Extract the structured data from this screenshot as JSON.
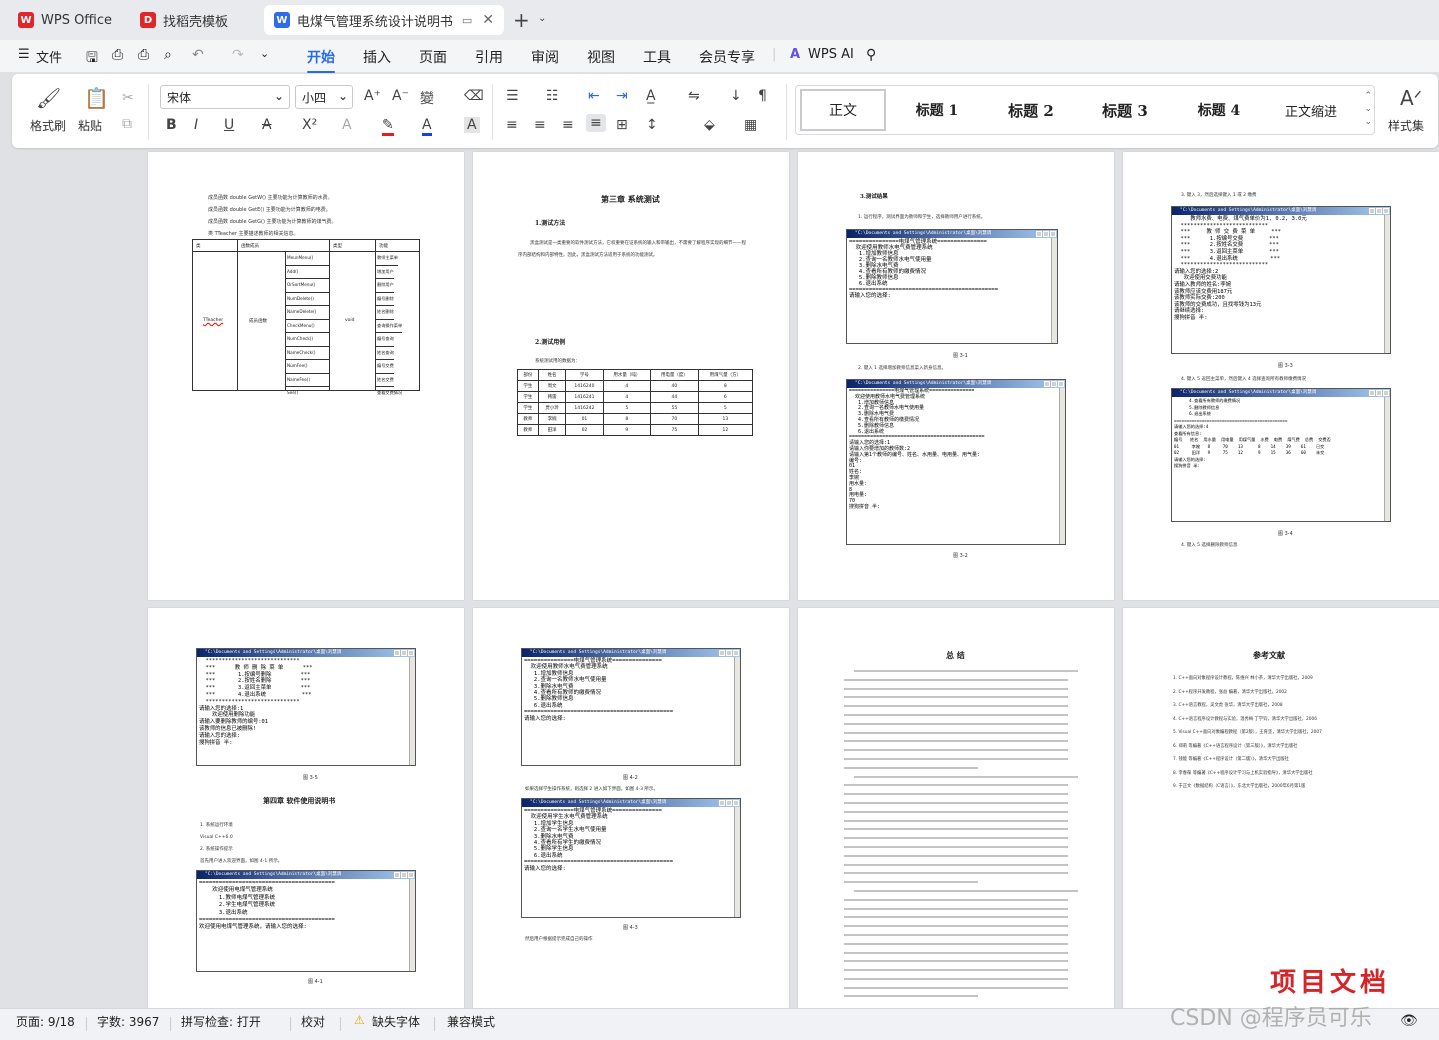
{
  "tabs": {
    "wps": "WPS Office",
    "template": "找稻壳模板",
    "doc": "电煤气管理系统设计说明书 .d"
  },
  "menu": {
    "file": "文件",
    "items": [
      "开始",
      "插入",
      "页面",
      "引用",
      "审阅",
      "视图",
      "工具",
      "会员专享"
    ],
    "ai": "WPS AI"
  },
  "ribbon": {
    "format_painter": "格式刷",
    "paste": "粘贴",
    "font": "宋体",
    "size": "小四",
    "styles": [
      "正文",
      "标题 1",
      "标题 2",
      "标题 3",
      "标题 4",
      "正文缩进"
    ],
    "style_set": "样式集"
  },
  "status": {
    "page": "页面: 9/18",
    "words": "字数: 3967",
    "spell": "拼写检查: 打开",
    "proof": "校对",
    "missing_font": "缺失字体",
    "compat": "兼容模式"
  },
  "doc": {
    "p9_lines": [
      "成员函数 double GetW() 主要功能为计算教师的水费。",
      "成员函数 double GetE() 主要功能为计算教师的电费。",
      "成员函数 double GetG() 主要功能为计算教师的煤气费。",
      "类 TTeacher 主要描述教师的相关信息。"
    ],
    "p9_table": {
      "header": [
        "类",
        "函数成员",
        "类型",
        "功能"
      ],
      "cls": "TTeacher",
      "member": "成员函数",
      "type": "void",
      "funcs": [
        "MeunMenu()",
        "Add()",
        "OrSortMenu()",
        "NumDelete()",
        "NameDelete()",
        "CheckMenu()",
        "NumCheck()",
        "NameCheck()",
        "NumFee()",
        "NameFee()",
        "See()"
      ],
      "desc": [
        "教师主菜单",
        "增加用户",
        "删除用户",
        "编号删除",
        "姓名删除",
        "查询操作菜单",
        "编号查询",
        "姓名查询",
        "编号交费",
        "姓名交费",
        "查看交费情况"
      ]
    },
    "ch3_title": "第三章 系统测试",
    "ch3_s1": "1.测试方法",
    "ch3_p1": "黑盒测试是一类重要的软件测试方法，它权重要在证系统的输入和带输出，不需要了解程序实现的细节——程序内部结构和内部特性。因此，黑盒测试方法适用于系统的功能测试。",
    "ch3_s2": "2.测试用例",
    "ch3_p2": "系统测试用的数据为：",
    "ch3_table": {
      "header": [
        "部份",
        "姓名",
        "学号",
        "用水量（吨）",
        "用电量（度）",
        "用煤气量（方）"
      ],
      "rows": [
        [
          "学生",
          "周文",
          "1416240",
          "4",
          "40",
          "8"
        ],
        [
          "学生",
          "韩雷",
          "1416241",
          "4",
          "44",
          "6"
        ],
        [
          "学生",
          "贾小玲",
          "1416242",
          "5",
          "55",
          "5"
        ],
        [
          "教师",
          "李婉",
          "01",
          "8",
          "70",
          "13"
        ],
        [
          "教师",
          "田洋",
          "02",
          "9",
          "75",
          "12"
        ]
      ]
    },
    "p11_heading": "3.测试结果",
    "p11_l1": "1. 运行程序，测试界面为教师和学生，选择教师用户进行系统。",
    "p11_l2": "2. 键入 1 选择增加教师信息菜入新身信息。",
    "console_title": "\"C:\\Documents and Settings\\Administrator\\桌面\\刘慧调",
    "console_menu": "===============电煤气管理系统===============\n  欢迎使用教师水电气费管理系统\n   1.增加教师信息\n   2.查询一名教师水电气使用量\n   3.删除水电气费\n   4.查看所有教师的缴费情况\n   5.删除教师信息\n   6.退出系统\n=============================================\n请输入您的选择:",
    "console_add": "===============电煤气管理系统===============\n  欢迎使用教师水电气费管理系统\n   1.增加教师信息\n   2.查询一名教师水电气使用量\n   3.删除水电气费\n   4.查看所有教师的缴费情况\n   5.删除教师信息\n   6.退出系统\n=============================================\n请输入您的选择:1\n请输入你要增加的教师数:2\n请输入第1个教师的编号、姓名、水用量、电用量、用气量:\n编号:\n01\n姓名:\n李婉\n用水量:\n8\n用电量:\n70\n搜狗拼音 半:",
    "p12_l1": "3. 键入 3，然后选择键入 1 或 2 缴费",
    "p12_l2": "4. 键入 5 返回主菜单，然后键入 4 选择查询所有教师缴费情况",
    "p12_l3": "4. 键入 5 选择删除教师信息",
    "console_fee": "     教师水费、电费、煤气费单价为1, 0.2, 3.0元\n  ***************************\n  ***     教 师 交 费 菜 单     ***\n  ***      1.按编号交费        ***\n  ***      2.按姓名交费        ***\n  ***      3.返回主菜单        ***\n  ***      4.退出系统          ***\n  ***************************\n请输入您的选择:2\n   欢迎使用交费功能\n请输入教师的姓名:李婉\n该教师应该交费用187元\n该教师实际交费:200\n该教师的交费成功，且找零钱为13元\n请继续选择:\n搜狗拼音 半:",
    "console_list": "      4.查看所有教师的缴费情况\n      5.删除教师信息\n      6.退出系统\n=============================================\n请输入您的选择:4\n查看所有信息:\n编号   姓名  用水量  用电量  用煤气量  水费  电费  煤气费  总费  交费否\n01     李婉   8     70    13      8    14    39    61    已交\n02     田洋   9     75    12      9    15    36    60    未交\n请输入您的选择:\n搜狗拼音 半:",
    "cap": [
      "图 3-1",
      "图 3-2",
      "图 3-3",
      "图 3-4",
      "图 3-5",
      "图 4-1",
      "图 4-2",
      "图 4-3"
    ],
    "console_del": "  *****************************\n  ***      教 师 删 除 菜 单      ***\n  ***       1.按编号删除         ***\n  ***       2.按姓名删除         ***\n  ***       3.返回主菜单         ***\n  ***       4.退出系统           ***\n  *****************************\n请输入您的选择:1\n    欢迎使用删除功能\n请输入要删除教师的编号:01\n该教师的信息已被删除!\n请输入您的选择:\n搜狗拼音 半:",
    "ch4_title": "第四章 软件使用说明书",
    "ch4_l1": "1. 系统运行环境",
    "ch4_l2": "Visual C++6.0",
    "ch4_l3": "2. 系统操作提示",
    "ch4_l4": "首先用户进入欢迎界面，如图 4-1 所示。",
    "console_welcome": "=========================================\n    欢迎使用电煤气管理系统\n      1.教师电煤气管理系统\n      2.学生电煤气管理系统\n      3.退出系统\n=========================================\n欢迎使用电煤气管理系统，请输入您的选择:",
    "p14_l1": "如果选择学生操作系统，则选择 2 进入如下界面，如图 4-3 所示。",
    "p14_l2": "然后用户根据提示完成自己的操作",
    "console_student": "===============电煤气管理系统===============\n  欢迎使用学生水电气费管理系统\n   1.增加学生信息\n   2.查询一名学生水电气使用量\n   3.删除水电气费\n   4.查看所有学生的缴费情况\n   5.删除学生信息\n   6.退出系统\n=============================================\n请输入您的选择:",
    "summary_title": "总 结",
    "refs_title": "参考文献",
    "refs": [
      "1. C++面向对象程序设计教程，陈维兴 林小茶，清华大学出版社，2009",
      "2. C++程序开发教程，张益 编著，清华大学出版社，2002",
      "3. C++语言教程，吴文虎 张华，清华大学出版社，2008",
      "4. C++语言程序设计教程与实验，温秀梅 丁学钧，清华大学出版社，2006",
      "5. Visual C++面向对象编程教程（第2版），王育坚，清华大学出版社，2007",
      "6. 郑莉 等编著《C++语言程序设计（第三版）》，清华大学出版社",
      "7. 钱能 等编著《C++程序设计（第二版）》，清华大学出版社",
      "8. 李春葆 等编著《C++程序设计学习与上机实验指导》，清华大学出版社",
      "9. 于正文《数据结构（C语言）》，东北大学出版社，2000年6月第1版"
    ]
  },
  "overlay": {
    "project": "项目文档",
    "watermark": "CSDN @程序员可乐"
  }
}
